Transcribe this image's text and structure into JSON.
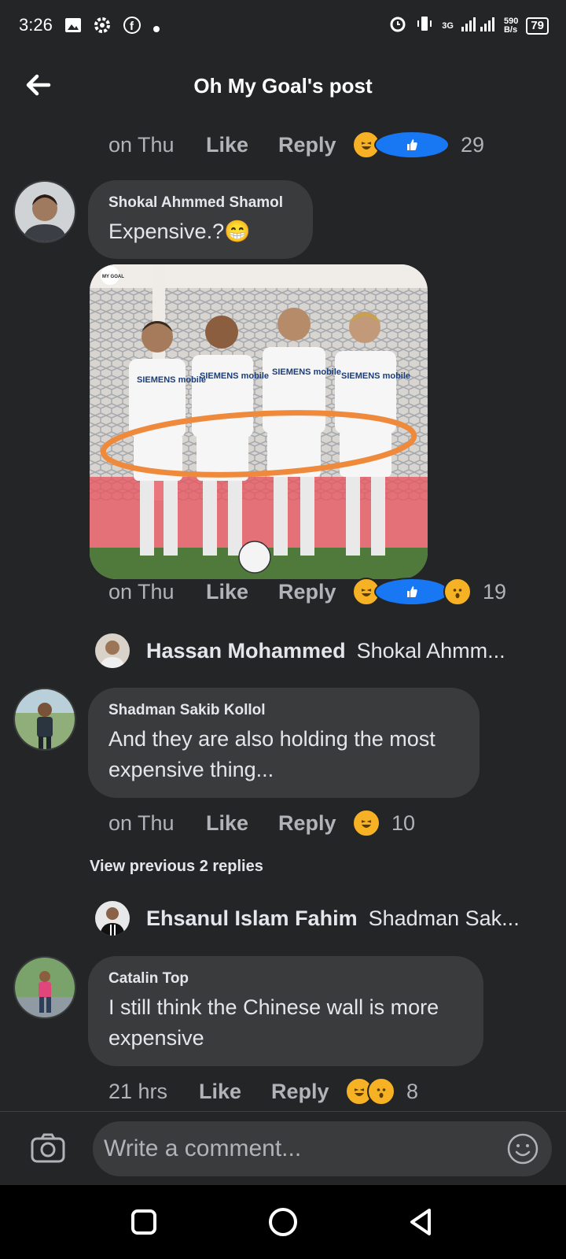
{
  "status_bar": {
    "time": "3:26",
    "network_speed": "590\nB/s",
    "network_type": "3G",
    "battery": "79"
  },
  "header": {
    "title": "Oh My Goal's post"
  },
  "comments": [
    {
      "time": "on Thu",
      "like": "Like",
      "reply": "Reply",
      "reactions": [
        "haha",
        "like"
      ],
      "count": "29"
    },
    {
      "author": "Shokal Ahmmed Shamol",
      "text": "Expensive.?😁",
      "time": "on Thu",
      "like": "Like",
      "reply": "Reply",
      "reactions": [
        "haha",
        "like",
        "wow"
      ],
      "count": "19",
      "image_badge": "MY GOAL",
      "shirt_texts": [
        "SIEMENS mobile",
        "SIEMENS mobile",
        "SIEMENS mobile",
        "SIEMENS mobile"
      ],
      "reply_preview": {
        "name": "Hassan Mohammed",
        "text": "Shokal Ahmm..."
      }
    },
    {
      "author": "Shadman Sakib Kollol",
      "text": "And they are also holding the most expensive thing...",
      "time": "on Thu",
      "like": "Like",
      "reply": "Reply",
      "reactions": [
        "haha"
      ],
      "count": "10",
      "view_previous": "View previous 2 replies",
      "reply_preview": {
        "name": "Ehsanul Islam Fahim",
        "text": "Shadman Sak..."
      }
    },
    {
      "author": "Catalin Top",
      "text": "I still think the Chinese wall is more expensive",
      "time": "21 hrs",
      "like": "Like",
      "reply": "Reply",
      "reactions": [
        "haha",
        "wow"
      ],
      "count": "8"
    }
  ],
  "composer": {
    "placeholder": "Write a comment..."
  },
  "colors": {
    "background": "#242526",
    "bubble": "#3a3b3c",
    "secondary_text": "#b0b3b8",
    "like_blue": "#1877f2",
    "haha_yellow": "#f7b125"
  }
}
